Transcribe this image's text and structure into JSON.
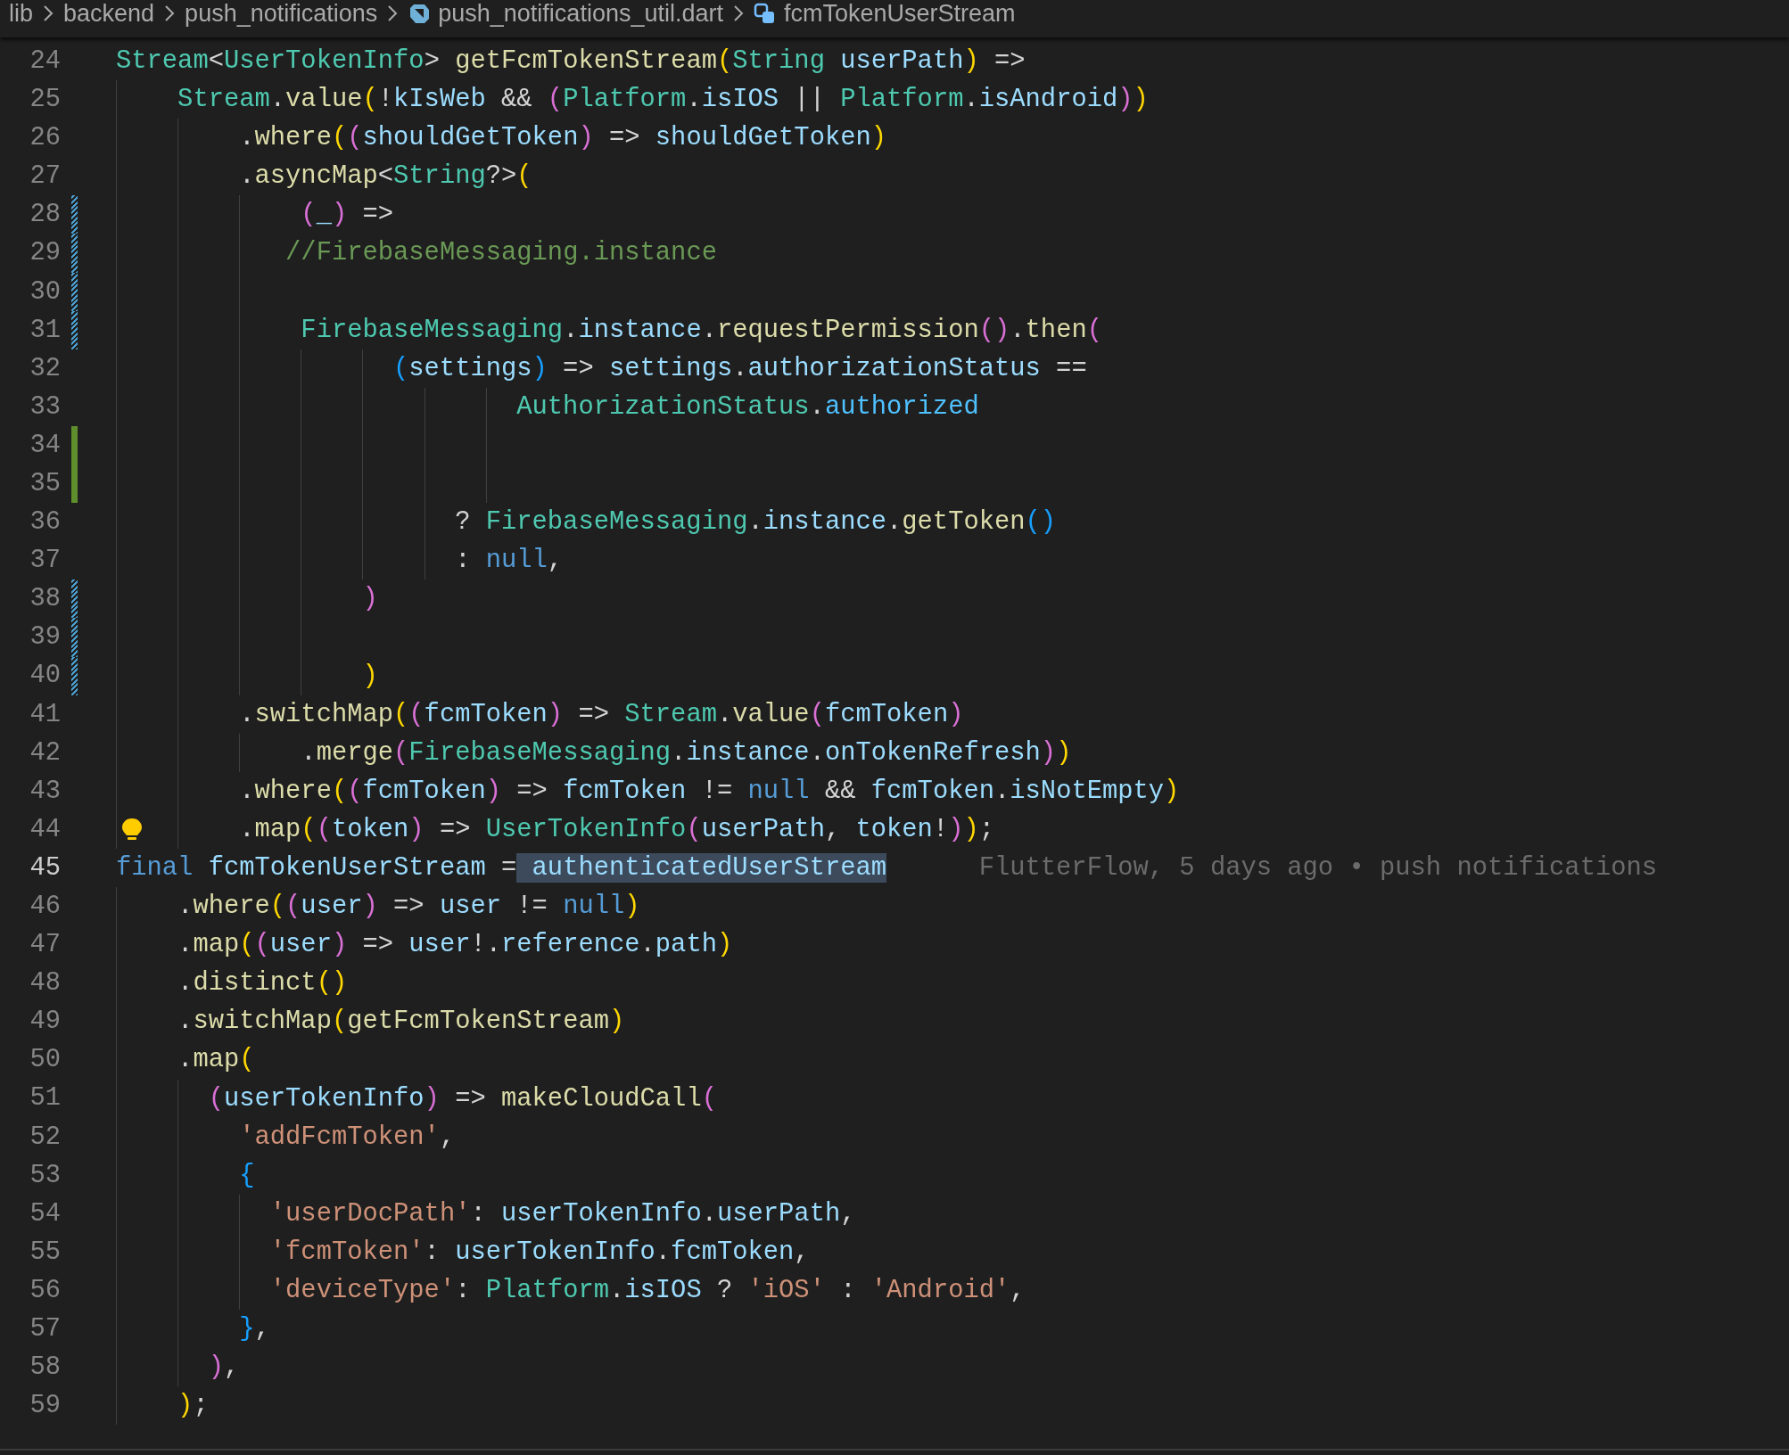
{
  "breadcrumbs": [
    {
      "kind": "folder",
      "label": "lib"
    },
    {
      "kind": "folder",
      "label": "backend"
    },
    {
      "kind": "folder",
      "label": "push_notifications"
    },
    {
      "kind": "file",
      "label": "push_notifications_util.dart"
    },
    {
      "kind": "symbol",
      "label": "fcmTokenUserStream"
    }
  ],
  "editor": {
    "lines": [
      {
        "number": "24",
        "tokens": [
          {
            "kind": "type",
            "text": "Stream"
          },
          {
            "kind": "plain",
            "text": "<"
          },
          {
            "kind": "type",
            "text": "UserTokenInfo"
          },
          {
            "kind": "plain",
            "text": "> "
          },
          {
            "kind": "function",
            "text": "getFcmTokenStream"
          },
          {
            "kind": "bracket1",
            "text": "("
          },
          {
            "kind": "type",
            "text": "String"
          },
          {
            "kind": "variable",
            "text": " userPath"
          },
          {
            "kind": "bracket1",
            "text": ")"
          },
          {
            "kind": "plain",
            "text": " =>"
          }
        ]
      },
      {
        "number": "25",
        "tokens": [
          {
            "kind": "type",
            "text": "    Stream"
          },
          {
            "kind": "plain",
            "text": "."
          },
          {
            "kind": "function",
            "text": "value"
          },
          {
            "kind": "bracket1",
            "text": "("
          },
          {
            "kind": "plain",
            "text": "!"
          },
          {
            "kind": "variable",
            "text": "kIsWeb"
          },
          {
            "kind": "plain",
            "text": " && "
          },
          {
            "kind": "bracket2",
            "text": "("
          },
          {
            "kind": "type",
            "text": "Platform"
          },
          {
            "kind": "plain",
            "text": "."
          },
          {
            "kind": "variable",
            "text": "isIOS"
          },
          {
            "kind": "plain",
            "text": " || "
          },
          {
            "kind": "type",
            "text": "Platform"
          },
          {
            "kind": "plain",
            "text": "."
          },
          {
            "kind": "variable",
            "text": "isAndroid"
          },
          {
            "kind": "bracket2",
            "text": ")"
          },
          {
            "kind": "bracket1",
            "text": ")"
          }
        ]
      },
      {
        "number": "26",
        "tokens": [
          {
            "kind": "plain",
            "text": "        ."
          },
          {
            "kind": "function",
            "text": "where"
          },
          {
            "kind": "bracket1",
            "text": "("
          },
          {
            "kind": "bracket2",
            "text": "("
          },
          {
            "kind": "variable",
            "text": "shouldGetToken"
          },
          {
            "kind": "bracket2",
            "text": ")"
          },
          {
            "kind": "plain",
            "text": " => "
          },
          {
            "kind": "variable",
            "text": "shouldGetToken"
          },
          {
            "kind": "bracket1",
            "text": ")"
          }
        ]
      },
      {
        "number": "27",
        "tokens": [
          {
            "kind": "plain",
            "text": "        ."
          },
          {
            "kind": "function",
            "text": "asyncMap"
          },
          {
            "kind": "plain",
            "text": "<"
          },
          {
            "kind": "type",
            "text": "String"
          },
          {
            "kind": "plain",
            "text": "?>"
          },
          {
            "kind": "bracket1",
            "text": "("
          }
        ]
      },
      {
        "number": "28",
        "modified": true,
        "tokens": [
          {
            "kind": "bracket2",
            "text": "            ("
          },
          {
            "kind": "variable",
            "text": "_"
          },
          {
            "kind": "bracket2",
            "text": ")"
          },
          {
            "kind": "plain",
            "text": " =>"
          }
        ]
      },
      {
        "number": "29",
        "modified": true,
        "tokens": [
          {
            "kind": "comment",
            "text": "           //FirebaseMessaging.instance"
          }
        ]
      },
      {
        "number": "30",
        "modified": true
      },
      {
        "number": "31",
        "modified": true,
        "tokens": [
          {
            "kind": "type",
            "text": "            FirebaseMessaging"
          },
          {
            "kind": "plain",
            "text": "."
          },
          {
            "kind": "variable",
            "text": "instance"
          },
          {
            "kind": "plain",
            "text": "."
          },
          {
            "kind": "function",
            "text": "requestPermission"
          },
          {
            "kind": "bracket2",
            "text": "()"
          },
          {
            "kind": "plain",
            "text": "."
          },
          {
            "kind": "function",
            "text": "then"
          },
          {
            "kind": "bracket2",
            "text": "("
          }
        ]
      },
      {
        "number": "32",
        "tokens": [
          {
            "kind": "bracket3",
            "text": "                  ("
          },
          {
            "kind": "variable",
            "text": "settings"
          },
          {
            "kind": "bracket3",
            "text": ")"
          },
          {
            "kind": "plain",
            "text": " => "
          },
          {
            "kind": "variable",
            "text": "settings"
          },
          {
            "kind": "plain",
            "text": "."
          },
          {
            "kind": "variable",
            "text": "authorizationStatus"
          },
          {
            "kind": "plain",
            "text": " =="
          }
        ]
      },
      {
        "number": "33",
        "tokens": [
          {
            "kind": "type",
            "text": "                          AuthorizationStatus"
          },
          {
            "kind": "plain",
            "text": "."
          },
          {
            "kind": "constant",
            "text": "authorized"
          }
        ]
      },
      {
        "number": "34",
        "added": true
      },
      {
        "number": "35",
        "added": true
      },
      {
        "number": "36",
        "tokens": [
          {
            "kind": "plain",
            "text": "                      ? "
          },
          {
            "kind": "type",
            "text": "FirebaseMessaging"
          },
          {
            "kind": "plain",
            "text": "."
          },
          {
            "kind": "variable",
            "text": "instance"
          },
          {
            "kind": "plain",
            "text": "."
          },
          {
            "kind": "function",
            "text": "getToken"
          },
          {
            "kind": "bracket3",
            "text": "()"
          }
        ]
      },
      {
        "number": "37",
        "tokens": [
          {
            "kind": "plain",
            "text": "                      : "
          },
          {
            "kind": "keyword",
            "text": "null"
          },
          {
            "kind": "plain",
            "text": ","
          }
        ]
      },
      {
        "number": "38",
        "modified": true,
        "tokens": [
          {
            "kind": "bracket2",
            "text": "                )"
          }
        ]
      },
      {
        "number": "39",
        "modified": true
      },
      {
        "number": "40",
        "modified": true,
        "tokens": [
          {
            "kind": "bracket1",
            "text": "                )"
          }
        ]
      },
      {
        "number": "41",
        "tokens": [
          {
            "kind": "plain",
            "text": "        ."
          },
          {
            "kind": "function",
            "text": "switchMap"
          },
          {
            "kind": "bracket1",
            "text": "("
          },
          {
            "kind": "bracket2",
            "text": "("
          },
          {
            "kind": "variable",
            "text": "fcmToken"
          },
          {
            "kind": "bracket2",
            "text": ")"
          },
          {
            "kind": "plain",
            "text": " => "
          },
          {
            "kind": "type",
            "text": "Stream"
          },
          {
            "kind": "plain",
            "text": "."
          },
          {
            "kind": "function",
            "text": "value"
          },
          {
            "kind": "bracket2",
            "text": "("
          },
          {
            "kind": "variable",
            "text": "fcmToken"
          },
          {
            "kind": "bracket2",
            "text": ")"
          }
        ]
      },
      {
        "number": "42",
        "tokens": [
          {
            "kind": "plain",
            "text": "            ."
          },
          {
            "kind": "function",
            "text": "merge"
          },
          {
            "kind": "bracket2",
            "text": "("
          },
          {
            "kind": "type",
            "text": "FirebaseMessaging"
          },
          {
            "kind": "plain",
            "text": "."
          },
          {
            "kind": "variable",
            "text": "instance"
          },
          {
            "kind": "plain",
            "text": "."
          },
          {
            "kind": "variable",
            "text": "onTokenRefresh"
          },
          {
            "kind": "bracket2",
            "text": ")"
          },
          {
            "kind": "bracket1",
            "text": ")"
          }
        ]
      },
      {
        "number": "43",
        "tokens": [
          {
            "kind": "plain",
            "text": "        ."
          },
          {
            "kind": "function",
            "text": "where"
          },
          {
            "kind": "bracket1",
            "text": "("
          },
          {
            "kind": "bracket2",
            "text": "("
          },
          {
            "kind": "variable",
            "text": "fcmToken"
          },
          {
            "kind": "bracket2",
            "text": ")"
          },
          {
            "kind": "plain",
            "text": " => "
          },
          {
            "kind": "variable",
            "text": "fcmToken"
          },
          {
            "kind": "plain",
            "text": " != "
          },
          {
            "kind": "keyword",
            "text": "null"
          },
          {
            "kind": "plain",
            "text": " && "
          },
          {
            "kind": "variable",
            "text": "fcmToken"
          },
          {
            "kind": "plain",
            "text": "."
          },
          {
            "kind": "variable",
            "text": "isNotEmpty"
          },
          {
            "kind": "bracket1",
            "text": ")"
          }
        ]
      },
      {
        "number": "44",
        "lightbulb": true,
        "tokens": [
          {
            "kind": "plain",
            "text": "        ."
          },
          {
            "kind": "function",
            "text": "map"
          },
          {
            "kind": "bracket1",
            "text": "("
          },
          {
            "kind": "bracket2",
            "text": "("
          },
          {
            "kind": "variable",
            "text": "token"
          },
          {
            "kind": "bracket2",
            "text": ")"
          },
          {
            "kind": "plain",
            "text": " => "
          },
          {
            "kind": "type",
            "text": "UserTokenInfo"
          },
          {
            "kind": "bracket2",
            "text": "("
          },
          {
            "kind": "variable",
            "text": "userPath"
          },
          {
            "kind": "plain",
            "text": ", "
          },
          {
            "kind": "variable",
            "text": "token"
          },
          {
            "kind": "plain",
            "text": "!"
          },
          {
            "kind": "bracket2",
            "text": ")"
          },
          {
            "kind": "bracket1",
            "text": ")"
          },
          {
            "kind": "plain",
            "text": ";"
          }
        ]
      },
      {
        "number": "45",
        "current": true,
        "blame": "FlutterFlow, 5 days ago • push notifications",
        "tokens": [
          {
            "kind": "keyword",
            "text": "final"
          },
          {
            "kind": "variable",
            "text": " fcmTokenUserStream"
          },
          {
            "kind": "plain",
            "text": " ="
          },
          {
            "kind": "variable",
            "text": " authenticatedUserStream",
            "highlighted": true
          }
        ]
      },
      {
        "number": "46",
        "tokens": [
          {
            "kind": "plain",
            "text": "    ."
          },
          {
            "kind": "function",
            "text": "where"
          },
          {
            "kind": "bracket1",
            "text": "("
          },
          {
            "kind": "bracket2",
            "text": "("
          },
          {
            "kind": "variable",
            "text": "user"
          },
          {
            "kind": "bracket2",
            "text": ")"
          },
          {
            "kind": "plain",
            "text": " => "
          },
          {
            "kind": "variable",
            "text": "user"
          },
          {
            "kind": "plain",
            "text": " != "
          },
          {
            "kind": "keyword",
            "text": "null"
          },
          {
            "kind": "bracket1",
            "text": ")"
          }
        ]
      },
      {
        "number": "47",
        "tokens": [
          {
            "kind": "plain",
            "text": "    ."
          },
          {
            "kind": "function",
            "text": "map"
          },
          {
            "kind": "bracket1",
            "text": "("
          },
          {
            "kind": "bracket2",
            "text": "("
          },
          {
            "kind": "variable",
            "text": "user"
          },
          {
            "kind": "bracket2",
            "text": ")"
          },
          {
            "kind": "plain",
            "text": " => "
          },
          {
            "kind": "variable",
            "text": "user"
          },
          {
            "kind": "plain",
            "text": "!."
          },
          {
            "kind": "variable",
            "text": "reference"
          },
          {
            "kind": "plain",
            "text": "."
          },
          {
            "kind": "variable",
            "text": "path"
          },
          {
            "kind": "bracket1",
            "text": ")"
          }
        ]
      },
      {
        "number": "48",
        "tokens": [
          {
            "kind": "plain",
            "text": "    ."
          },
          {
            "kind": "function",
            "text": "distinct"
          },
          {
            "kind": "bracket1",
            "text": "()"
          }
        ]
      },
      {
        "number": "49",
        "tokens": [
          {
            "kind": "plain",
            "text": "    ."
          },
          {
            "kind": "function",
            "text": "switchMap"
          },
          {
            "kind": "bracket1",
            "text": "("
          },
          {
            "kind": "function",
            "text": "getFcmTokenStream"
          },
          {
            "kind": "bracket1",
            "text": ")"
          }
        ]
      },
      {
        "number": "50",
        "tokens": [
          {
            "kind": "plain",
            "text": "    ."
          },
          {
            "kind": "function",
            "text": "map"
          },
          {
            "kind": "bracket1",
            "text": "("
          }
        ]
      },
      {
        "number": "51",
        "tokens": [
          {
            "kind": "bracket2",
            "text": "      ("
          },
          {
            "kind": "variable",
            "text": "userTokenInfo"
          },
          {
            "kind": "bracket2",
            "text": ")"
          },
          {
            "kind": "plain",
            "text": " => "
          },
          {
            "kind": "function",
            "text": "makeCloudCall"
          },
          {
            "kind": "bracket2",
            "text": "("
          }
        ]
      },
      {
        "number": "52",
        "tokens": [
          {
            "kind": "string",
            "text": "        'addFcmToken'"
          },
          {
            "kind": "plain",
            "text": ","
          }
        ]
      },
      {
        "number": "53",
        "tokens": [
          {
            "kind": "bracket3",
            "text": "        {"
          }
        ]
      },
      {
        "number": "54",
        "tokens": [
          {
            "kind": "string",
            "text": "          'userDocPath'"
          },
          {
            "kind": "plain",
            "text": ": "
          },
          {
            "kind": "variable",
            "text": "userTokenInfo"
          },
          {
            "kind": "plain",
            "text": "."
          },
          {
            "kind": "variable",
            "text": "userPath"
          },
          {
            "kind": "plain",
            "text": ","
          }
        ]
      },
      {
        "number": "55",
        "tokens": [
          {
            "kind": "string",
            "text": "          'fcmToken'"
          },
          {
            "kind": "plain",
            "text": ": "
          },
          {
            "kind": "variable",
            "text": "userTokenInfo"
          },
          {
            "kind": "plain",
            "text": "."
          },
          {
            "kind": "variable",
            "text": "fcmToken"
          },
          {
            "kind": "plain",
            "text": ","
          }
        ]
      },
      {
        "number": "56",
        "tokens": [
          {
            "kind": "string",
            "text": "          'deviceType'"
          },
          {
            "kind": "plain",
            "text": ": "
          },
          {
            "kind": "type",
            "text": "Platform"
          },
          {
            "kind": "plain",
            "text": "."
          },
          {
            "kind": "variable",
            "text": "isIOS"
          },
          {
            "kind": "plain",
            "text": " ? "
          },
          {
            "kind": "string",
            "text": "'iOS'"
          },
          {
            "kind": "plain",
            "text": " : "
          },
          {
            "kind": "string",
            "text": "'Android'"
          },
          {
            "kind": "plain",
            "text": ","
          }
        ]
      },
      {
        "number": "57",
        "tokens": [
          {
            "kind": "bracket3",
            "text": "        }"
          },
          {
            "kind": "plain",
            "text": ","
          }
        ]
      },
      {
        "number": "58",
        "tokens": [
          {
            "kind": "bracket2",
            "text": "      )"
          },
          {
            "kind": "plain",
            "text": ","
          }
        ]
      },
      {
        "number": "59",
        "tokens": [
          {
            "kind": "bracket1",
            "text": "    )"
          },
          {
            "kind": "plain",
            "text": ";"
          }
        ]
      }
    ]
  }
}
